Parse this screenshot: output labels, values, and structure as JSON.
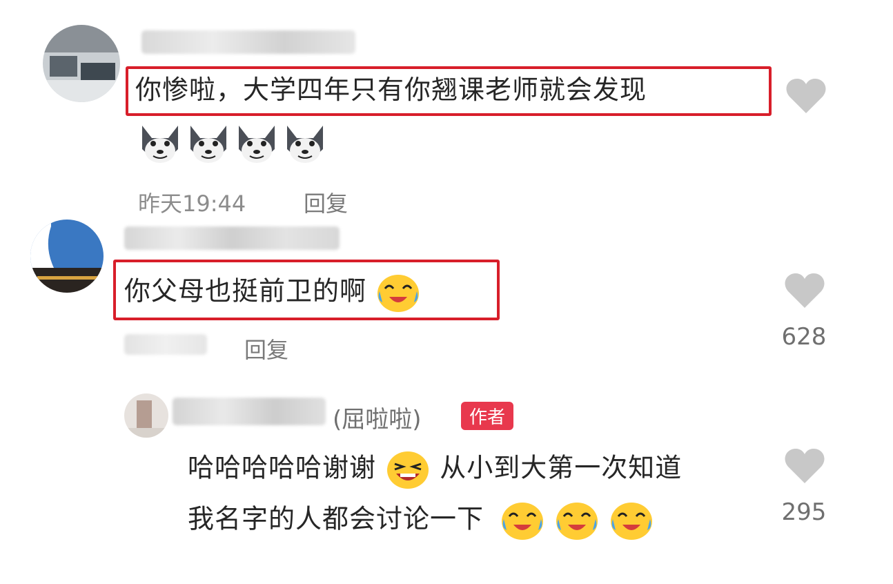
{
  "comments": [
    {
      "text": "你惨啦，大学四年只有你翘课老师就会发现",
      "time": "昨天19:44",
      "reply_label": "回复"
    },
    {
      "text": "你父母也挺前卫的啊",
      "reply_label": "回复",
      "likes": "628"
    }
  ],
  "reply": {
    "name_suffix": "(屈啦啦)",
    "badge": "作者",
    "line1_a": "哈哈哈哈哈谢谢",
    "line1_b": "从小到大第一次知道",
    "line2": "我名字的人都会讨论一下",
    "likes": "295"
  },
  "colors": {
    "highlight": "#d81e2a",
    "heart": "#c8c8c8",
    "badge": "#e8384d"
  }
}
